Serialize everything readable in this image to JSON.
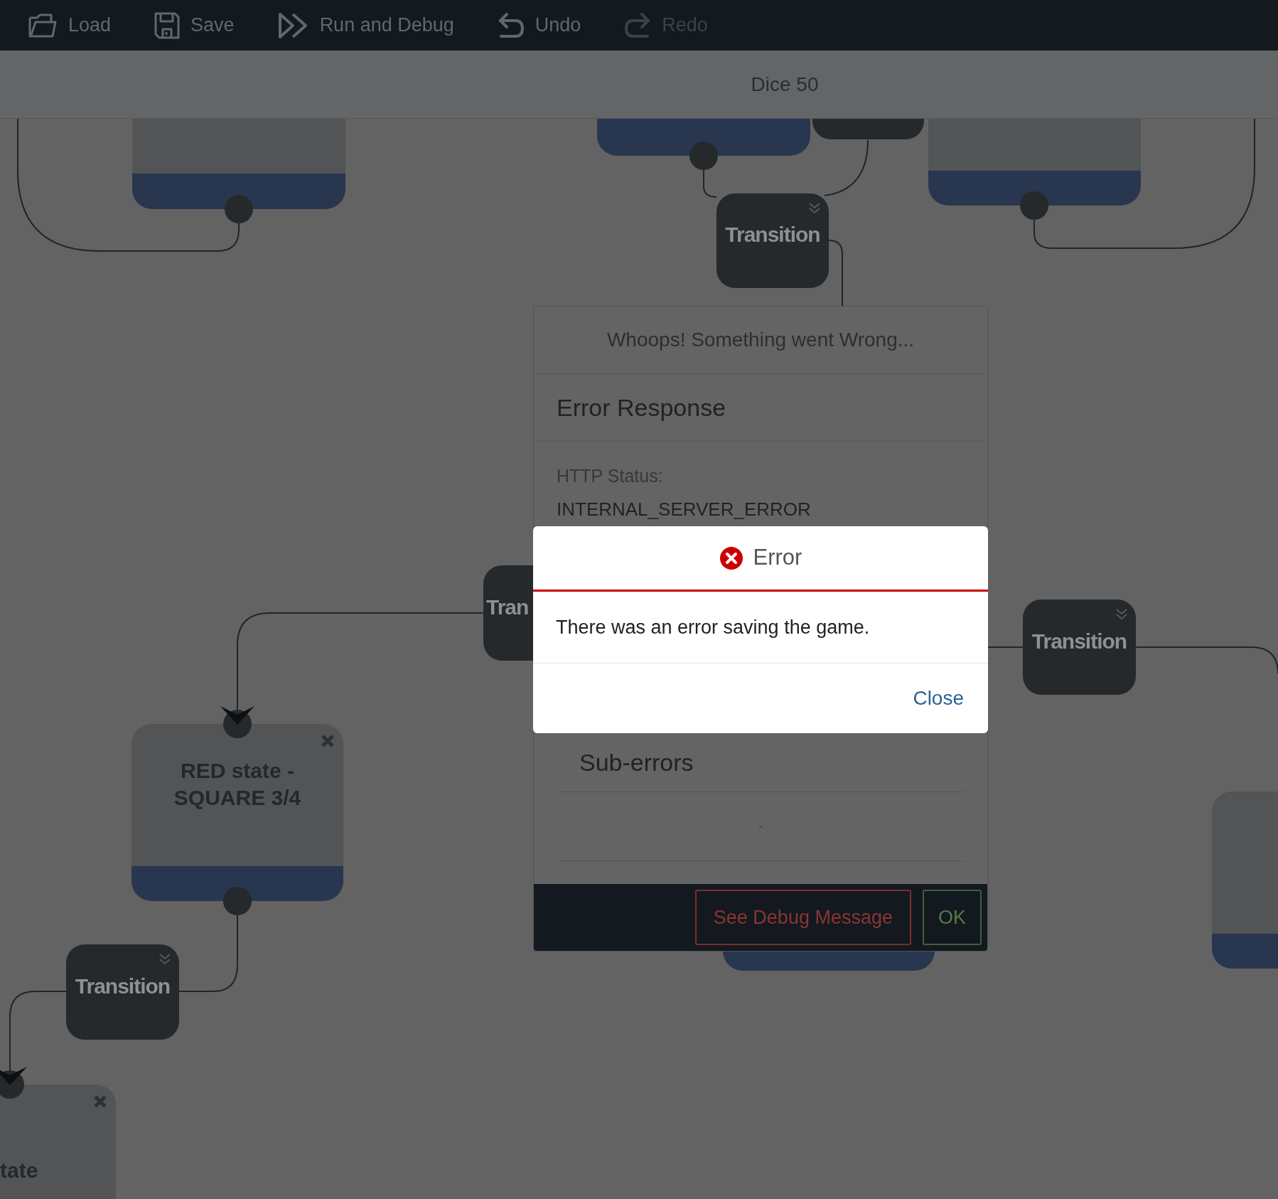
{
  "toolbar": [
    {
      "label": "Load",
      "kind": "load",
      "disabled": false
    },
    {
      "label": "Save",
      "kind": "save",
      "disabled": false
    },
    {
      "label": "Run and Debug",
      "kind": "run",
      "disabled": false
    },
    {
      "label": "Undo",
      "kind": "undo",
      "disabled": false
    },
    {
      "label": "Redo",
      "kind": "redo",
      "disabled": true
    }
  ],
  "header": {
    "title": "Dice 50"
  },
  "canvas": {
    "nodes": [
      {
        "kind": "state"
      },
      {
        "kind": "state"
      },
      {
        "kind": "transition"
      },
      {
        "kind": "transition",
        "label": "Transition"
      },
      {
        "kind": "state"
      },
      {
        "kind": "transition",
        "label": "Tran"
      },
      {
        "kind": "transition",
        "label": "Transition"
      },
      {
        "kind": "state",
        "label": "RED state - SQUARE 3/4"
      },
      {
        "kind": "state"
      },
      {
        "kind": "transition",
        "label": "Transition"
      },
      {
        "kind": "state",
        "label": "tate"
      },
      {
        "kind": "state"
      }
    ]
  },
  "error_dialog": {
    "title": "Whoops! Something went Wrong...",
    "section": "Error Response",
    "status_label": "HTTP Status:",
    "status_value": "INTERNAL_SERVER_ERROR",
    "sub_errors_heading": "Sub-errors",
    "sub_error": "-",
    "buttons": [
      {
        "label": "See Debug Message",
        "kind": "danger"
      },
      {
        "label": "OK",
        "kind": "success"
      }
    ]
  },
  "alert": {
    "title": "Error",
    "message": "There was an error saving the game.",
    "button": "Close"
  }
}
